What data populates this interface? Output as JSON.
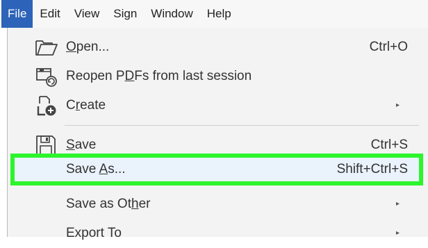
{
  "menubar": {
    "items": [
      "File",
      "Edit",
      "View",
      "Sign",
      "Window",
      "Help"
    ]
  },
  "file_menu": {
    "open": {
      "label_pre": "",
      "label_u": "O",
      "label_post": "pen...",
      "shortcut": "Ctrl+O"
    },
    "reopen": {
      "label_pre": "Reopen P",
      "label_u": "D",
      "label_post": "Fs from last session"
    },
    "create": {
      "label_pre": "C",
      "label_u": "r",
      "label_post": "eate",
      "arrow": "▸"
    },
    "save": {
      "label_pre": "",
      "label_u": "S",
      "label_post": "ave",
      "shortcut": "Ctrl+S"
    },
    "save_as": {
      "label_pre": "Save ",
      "label_u": "A",
      "label_post": "s...",
      "shortcut": "Shift+Ctrl+S"
    },
    "save_as_other": {
      "label_pre": "Save as Ot",
      "label_u": "h",
      "label_post": "er",
      "arrow": "▸"
    },
    "export_to": {
      "label_pre": "Export To",
      "label_u": "",
      "label_post": "",
      "arrow": "▸"
    }
  },
  "colors": {
    "menubar_bg": "#f7f7f7",
    "active_menu_bg": "#2d63b8",
    "menu_bg": "#f3f3f3",
    "highlight_border": "#2df52d",
    "highlight_bg": "#eaf2fb"
  }
}
